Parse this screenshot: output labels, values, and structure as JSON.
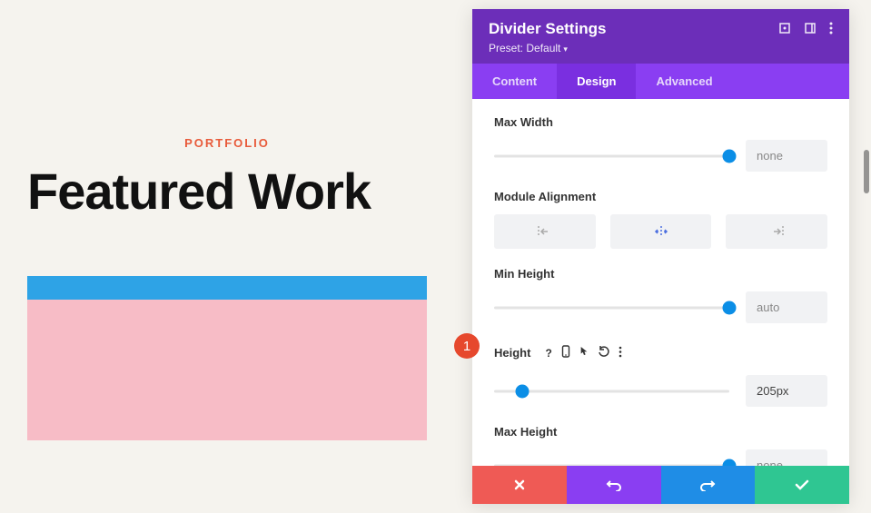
{
  "preview": {
    "eyebrow": "PORTFOLIO",
    "title": "Featured Work"
  },
  "panel": {
    "title": "Divider Settings",
    "preset_label": "Preset: Default",
    "tabs": {
      "content": "Content",
      "design": "Design",
      "advanced": "Advanced"
    }
  },
  "settings": {
    "max_width": {
      "label": "Max Width",
      "value": "none",
      "position": 100
    },
    "alignment": {
      "label": "Module Alignment"
    },
    "min_height": {
      "label": "Min Height",
      "value": "auto",
      "position": 100
    },
    "height": {
      "label": "Height",
      "value": "205px",
      "position": 12
    },
    "max_height": {
      "label": "Max Height",
      "value": "none",
      "position": 100
    }
  },
  "annotation": {
    "number": "1"
  }
}
